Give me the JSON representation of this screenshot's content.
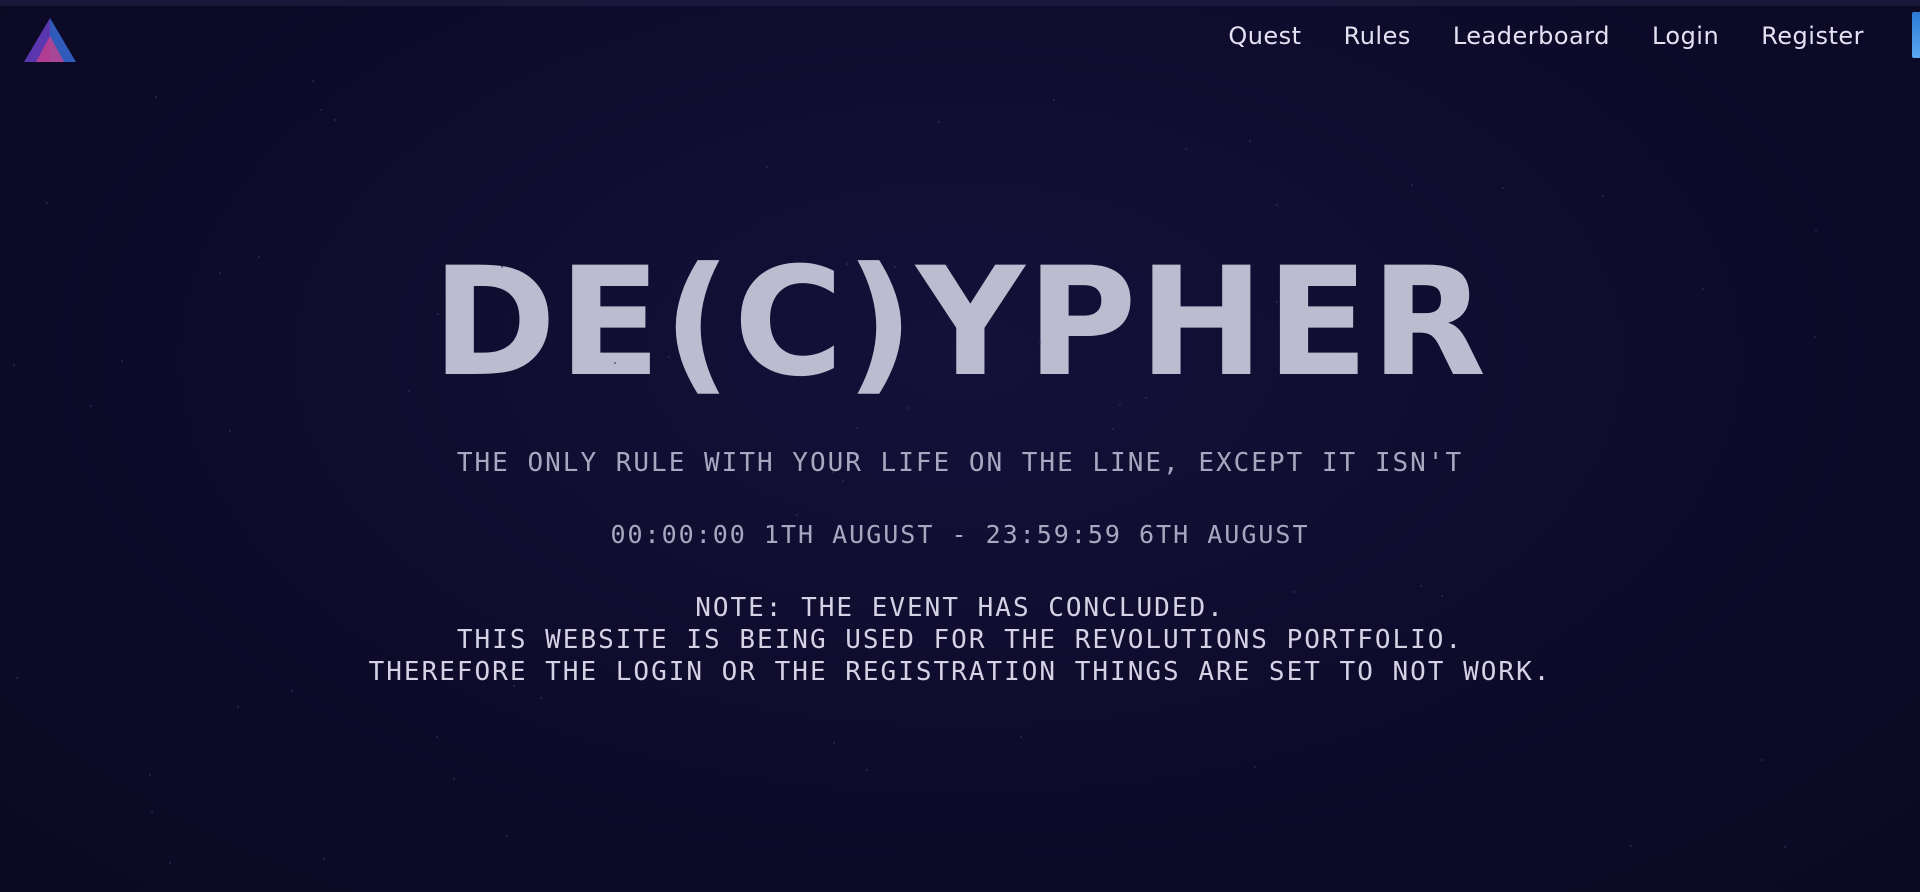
{
  "nav": {
    "items": [
      {
        "label": "Quest",
        "name": "nav-quest"
      },
      {
        "label": "Rules",
        "name": "nav-rules"
      },
      {
        "label": "Leaderboard",
        "name": "nav-leaderboard"
      },
      {
        "label": "Login",
        "name": "nav-login"
      },
      {
        "label": "Register",
        "name": "nav-register"
      }
    ]
  },
  "hero": {
    "title": "DE(C)YPHER",
    "tagline": "THE ONLY RULE WITH YOUR LIFE ON THE LINE, EXCEPT IT ISN'T",
    "dates": "00:00:00 1TH AUGUST - 23:59:59 6TH AUGUST",
    "notice": [
      "NOTE: THE EVENT HAS CONCLUDED.",
      "THIS WEBSITE IS BEING USED FOR THE REVOLUTIONS PORTFOLIO.",
      "THEREFORE THE LOGIN OR THE REGISTRATION THINGS ARE SET TO NOT WORK."
    ]
  },
  "colors": {
    "background": "#0c0a26",
    "text": "#d8d6e8",
    "logo_purple": "#6a3fc8",
    "logo_pink": "#d0408a",
    "logo_blue": "#3b6fe0",
    "edge_accent": "#3a8ae0"
  },
  "icons": {
    "logo": "triangle-logo-icon"
  }
}
